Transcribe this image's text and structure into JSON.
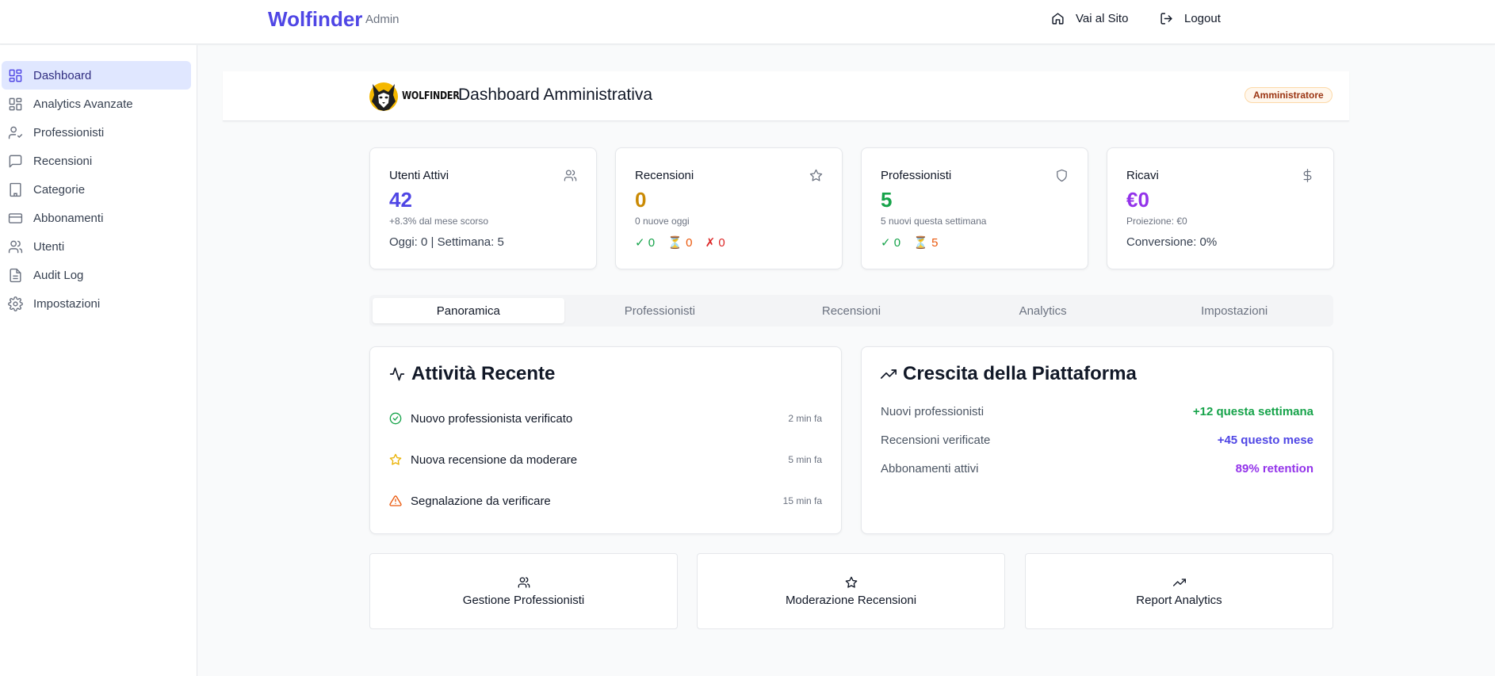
{
  "topbar": {
    "brand": "Wolfinder",
    "brand_sub": "Admin",
    "home_icon": "home-icon",
    "site_link": "Vai al Sito",
    "logout_icon": "logout-icon",
    "logout": "Logout"
  },
  "sidebar": {
    "items": [
      {
        "label": "Dashboard",
        "icon": "layout-grid-icon",
        "active": true
      },
      {
        "label": "Analytics Avanzate",
        "icon": "layout-grid-icon"
      },
      {
        "label": "Professionisti",
        "icon": "user-check-icon"
      },
      {
        "label": "Recensioni",
        "icon": "message-square-icon"
      },
      {
        "label": "Categorie",
        "icon": "building-icon"
      },
      {
        "label": "Abbonamenti",
        "icon": "credit-card-icon"
      },
      {
        "label": "Utenti",
        "icon": "users-icon"
      },
      {
        "label": "Audit Log",
        "icon": "file-text-icon"
      },
      {
        "label": "Impostazioni",
        "icon": "gear-icon"
      }
    ]
  },
  "header": {
    "logo_text": "WOLFINDER",
    "title": "Dashboard Amministrativa",
    "role_badge": "Amministratore"
  },
  "stats": [
    {
      "title": "Utenti Attivi",
      "icon": "users-icon",
      "value": "42",
      "value_color": "#4f46e5",
      "sub": "+8.3% dal mese scorso",
      "foot": "Oggi: 0 | Settimana: 5"
    },
    {
      "title": "Recensioni",
      "icon": "star-icon",
      "value": "0",
      "value_color": "#ca8a04",
      "sub": "0 nuove oggi",
      "approved": "✓ 0",
      "pending": "⏳ 0",
      "rejected": "✗ 0"
    },
    {
      "title": "Professionisti",
      "icon": "shield-icon",
      "value": "5",
      "value_color": "#16a34a",
      "sub": "5 nuovi questa settimana",
      "verified": "✓ 0",
      "pending": "⏳ 5"
    },
    {
      "title": "Ricavi",
      "icon": "dollar-icon",
      "value": "€0",
      "value_color": "#9333ea",
      "sub": "Proiezione: €0",
      "foot": "Conversione: 0%"
    }
  ],
  "tabs": [
    "Panoramica",
    "Professionisti",
    "Recensioni",
    "Analytics",
    "Impostazioni"
  ],
  "activity": {
    "title": "Attività Recente",
    "items": [
      {
        "text": "Nuovo professionista verificato",
        "time": "2 min fa",
        "icon": "check-circle-icon"
      },
      {
        "text": "Nuova recensione da moderare",
        "time": "5 min fa",
        "icon": "star-icon"
      },
      {
        "text": "Segnalazione da verificare",
        "time": "15 min fa",
        "icon": "alert-triangle-icon"
      }
    ]
  },
  "growth": {
    "title": "Crescita della Piattaforma",
    "rows": [
      {
        "label": "Nuovi professionisti",
        "value": "+12 questa settimana",
        "color": "#16a34a"
      },
      {
        "label": "Recensioni verificate",
        "value": "+45 questo mese",
        "color": "#4f46e5"
      },
      {
        "label": "Abbonamenti attivi",
        "value": "89% retention",
        "color": "#9333ea"
      }
    ]
  },
  "actions": [
    {
      "label": "Gestione Professionisti",
      "icon": "users-icon"
    },
    {
      "label": "Moderazione Recensioni",
      "icon": "star-icon"
    },
    {
      "label": "Report Analytics",
      "icon": "trending-up-icon"
    }
  ]
}
